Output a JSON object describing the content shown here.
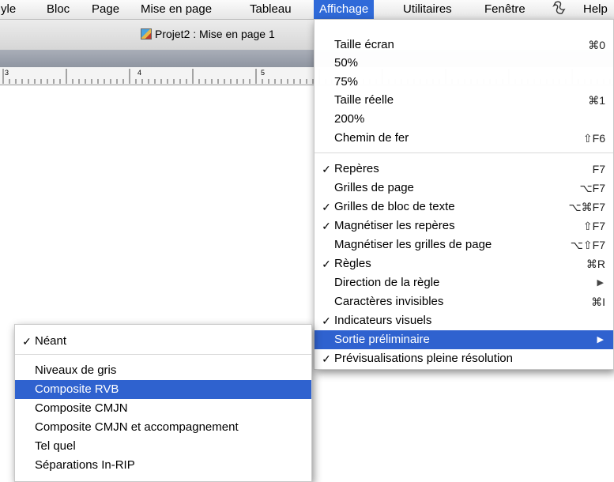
{
  "menubar": {
    "items": [
      "yle",
      "Bloc",
      "Page",
      "Mise en page",
      "Tableau",
      "Affichage",
      "Utilitaires",
      "Fenêtre",
      "Help"
    ],
    "script_icon": "script-icon"
  },
  "window": {
    "title": "Projet2 : Mise en page 1"
  },
  "ruler": {
    "labels": [
      "3",
      "4",
      "5"
    ]
  },
  "affichage_menu": {
    "items": [
      {
        "label": "Taille écran",
        "shortcut": "⌘0",
        "checked": false
      },
      {
        "label": "50%",
        "shortcut": "",
        "checked": false
      },
      {
        "label": "75%",
        "shortcut": "",
        "checked": false
      },
      {
        "label": "Taille réelle",
        "shortcut": "⌘1",
        "checked": false
      },
      {
        "label": "200%",
        "shortcut": "",
        "checked": false
      },
      {
        "label": "Chemin de fer",
        "shortcut": "⇧F6",
        "checked": false
      },
      {
        "label": "Repères",
        "shortcut": "F7",
        "checked": true
      },
      {
        "label": "Grilles de page",
        "shortcut": "⌥F7",
        "checked": false
      },
      {
        "label": "Grilles de bloc de texte",
        "shortcut": "⌥⌘F7",
        "checked": true
      },
      {
        "label": "Magnétiser les repères",
        "shortcut": "⇧F7",
        "checked": true
      },
      {
        "label": "Magnétiser les grilles de page",
        "shortcut": "⌥⇧F7",
        "checked": false
      },
      {
        "label": "Règles",
        "shortcut": "⌘R",
        "checked": true
      },
      {
        "label": "Direction de la règle",
        "shortcut": "",
        "checked": false,
        "submenu": true
      },
      {
        "label": "Caractères invisibles",
        "shortcut": "⌘I",
        "checked": false
      },
      {
        "label": "Indicateurs visuels",
        "shortcut": "",
        "checked": true
      },
      {
        "label": "Sortie préliminaire",
        "shortcut": "",
        "checked": false,
        "submenu": true,
        "selected": true
      },
      {
        "label": "Prévisualisations pleine résolution",
        "shortcut": "",
        "checked": true
      }
    ]
  },
  "sortie_submenu": {
    "items": [
      {
        "label": "Néant",
        "checked": true
      },
      {
        "label": "Niveaux de gris",
        "checked": false
      },
      {
        "label": "Composite RVB",
        "checked": false,
        "selected": true
      },
      {
        "label": "Composite CMJN",
        "checked": false
      },
      {
        "label": "Composite CMJN et accompagnement",
        "checked": false
      },
      {
        "label": "Tel quel",
        "checked": false
      },
      {
        "label": "Séparations In-RIP",
        "checked": false
      }
    ]
  },
  "check_glyph": "✓",
  "submenu_glyph": "▶",
  "colors": {
    "selection": "#2f62cf"
  }
}
